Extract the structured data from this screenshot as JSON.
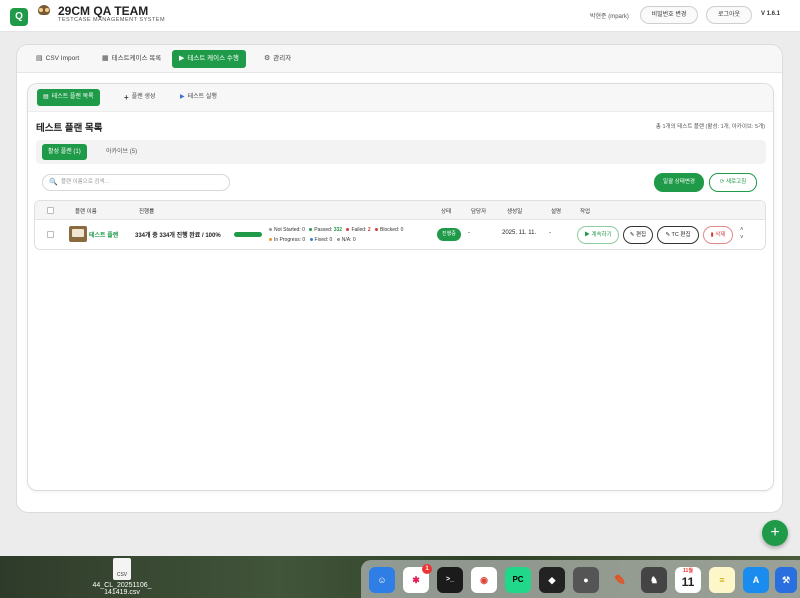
{
  "header": {
    "logo_badge": "Q",
    "owl_label": "29CM QA TEAM",
    "title": "29CM QA TEAM",
    "subtitle": "TESTCASE MANAGEMENT SYSTEM",
    "user": "박현준 (mpark)",
    "change_password": "비밀번호 변경",
    "logout": "로그아웃",
    "version": "V 1.6.1"
  },
  "main_tabs": [
    {
      "label": "CSV Import",
      "icon": "file-icon"
    },
    {
      "label": "테스트케이스 목록",
      "icon": "list-icon"
    },
    {
      "label": "테스트 케이스 수행",
      "icon": "play-icon"
    },
    {
      "label": "관리자",
      "icon": "gear-icon"
    }
  ],
  "sub_tabs": [
    {
      "label": "테스트 플랜 목록",
      "icon": "clipboard-icon"
    },
    {
      "label": "플랜 생성",
      "icon": "plus-icon"
    },
    {
      "label": "테스트 실행",
      "icon": "play-icon"
    }
  ],
  "section": {
    "title": "테스트 플랜 목록",
    "summary": "총 1개의 테스트 플랜 (활성: 1개, 아카이브: 5개)"
  },
  "filters": [
    {
      "label": "활성 플랜 (1)"
    },
    {
      "label": "아카이브 (5)"
    }
  ],
  "search": {
    "placeholder": "플랜 이름으로 검색..."
  },
  "toolbar": {
    "bulk_status": "일괄 상태변경",
    "refresh": "새로고침"
  },
  "table": {
    "headers": {
      "name": "플랜 이름",
      "progress": "진행률",
      "status": "상태",
      "assignee": "담당자",
      "created": "생성일",
      "description": "설명",
      "actions": "작업"
    },
    "rows": [
      {
        "name": "테스트 플랜",
        "progress_text": "334개 중 334개 진행 완료 / 100%",
        "progress": 1.0,
        "not_started": "Not Started: 0",
        "passed_label": "Passed:",
        "passed": "332",
        "failed_label": "Failed:",
        "failed": "2",
        "blocked": "Blocked: 0",
        "in_progress": "In Progress: 0",
        "fixed": "Fixed: 0",
        "na": "N/A: 0",
        "status": "진행중",
        "assignee": "-",
        "created": "2025. 11. 11.",
        "description": "-",
        "continue": "계속하기",
        "edit": "편집",
        "tc_edit": "TC 편집",
        "delete": "삭제"
      }
    ]
  },
  "desktop": {
    "file_ext": "CSV",
    "file_name_1": "44_CL_20251106_",
    "file_name_2": "141419.csv"
  },
  "dock": {
    "slack_badge": "1",
    "calendar_month": "11월",
    "calendar_day": "11"
  },
  "colors": {
    "accent": "#1f9a48",
    "danger": "#d43a3a"
  }
}
